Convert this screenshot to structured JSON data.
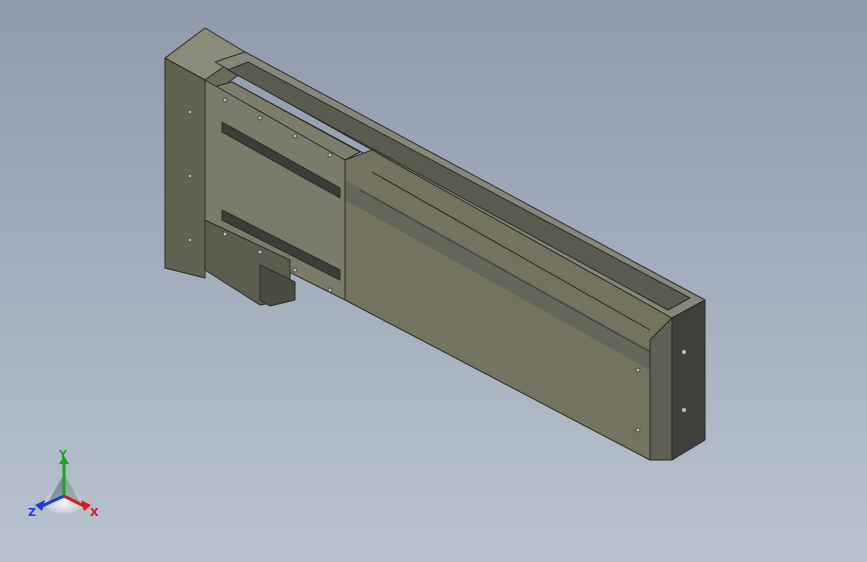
{
  "viewport": {
    "background_top": "#8f9bab",
    "background_bottom": "#b9c3cf"
  },
  "model": {
    "icon": "linear-actuator-module-model",
    "body_color": "#73735f",
    "shadow_color": "#55564a",
    "edge_color": "#2a2a26"
  },
  "triad": {
    "x_label": "X",
    "y_label": "Y",
    "z_label": "Z",
    "x_color": "#d11e1e",
    "y_color": "#1ea51e",
    "z_color": "#1e3ecf"
  }
}
